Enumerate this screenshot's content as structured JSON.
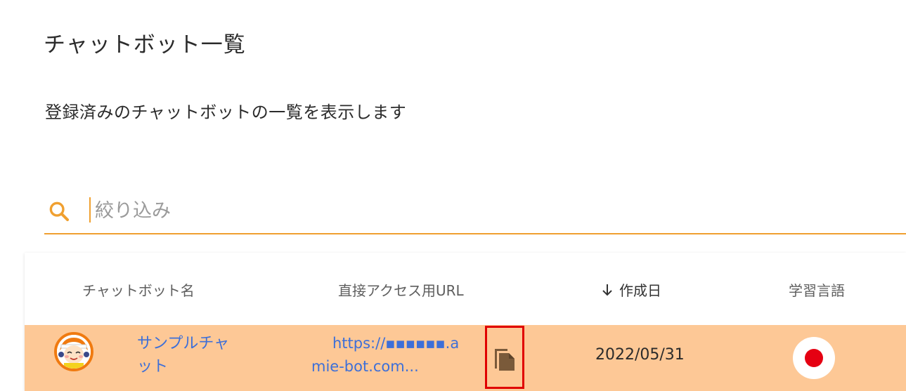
{
  "page": {
    "title": "チャットボット一覧",
    "description": "登録済みのチャットボットの一覧を表示します"
  },
  "search": {
    "placeholder": "絞り込み",
    "value": ""
  },
  "table": {
    "columns": {
      "name": "チャットボット名",
      "url": "直接アクセス用URL",
      "created": "作成日",
      "language": "学習言語"
    },
    "sort": {
      "column": "created",
      "direction": "desc"
    },
    "rows": [
      {
        "name": "サンプルチャット",
        "url_line1": "https://▪▪▪▪▪▪.a",
        "url_line2": "mie-bot.com...",
        "created": "2022/05/31",
        "language_flag": "japan-flag"
      }
    ]
  },
  "colors": {
    "accent": "#f0a030",
    "row_highlight": "#fdc896",
    "link": "#3d6fd8",
    "copy_icon": "#7a5a3a",
    "highlight_box": "#e00000",
    "flag_red": "#e50012"
  }
}
